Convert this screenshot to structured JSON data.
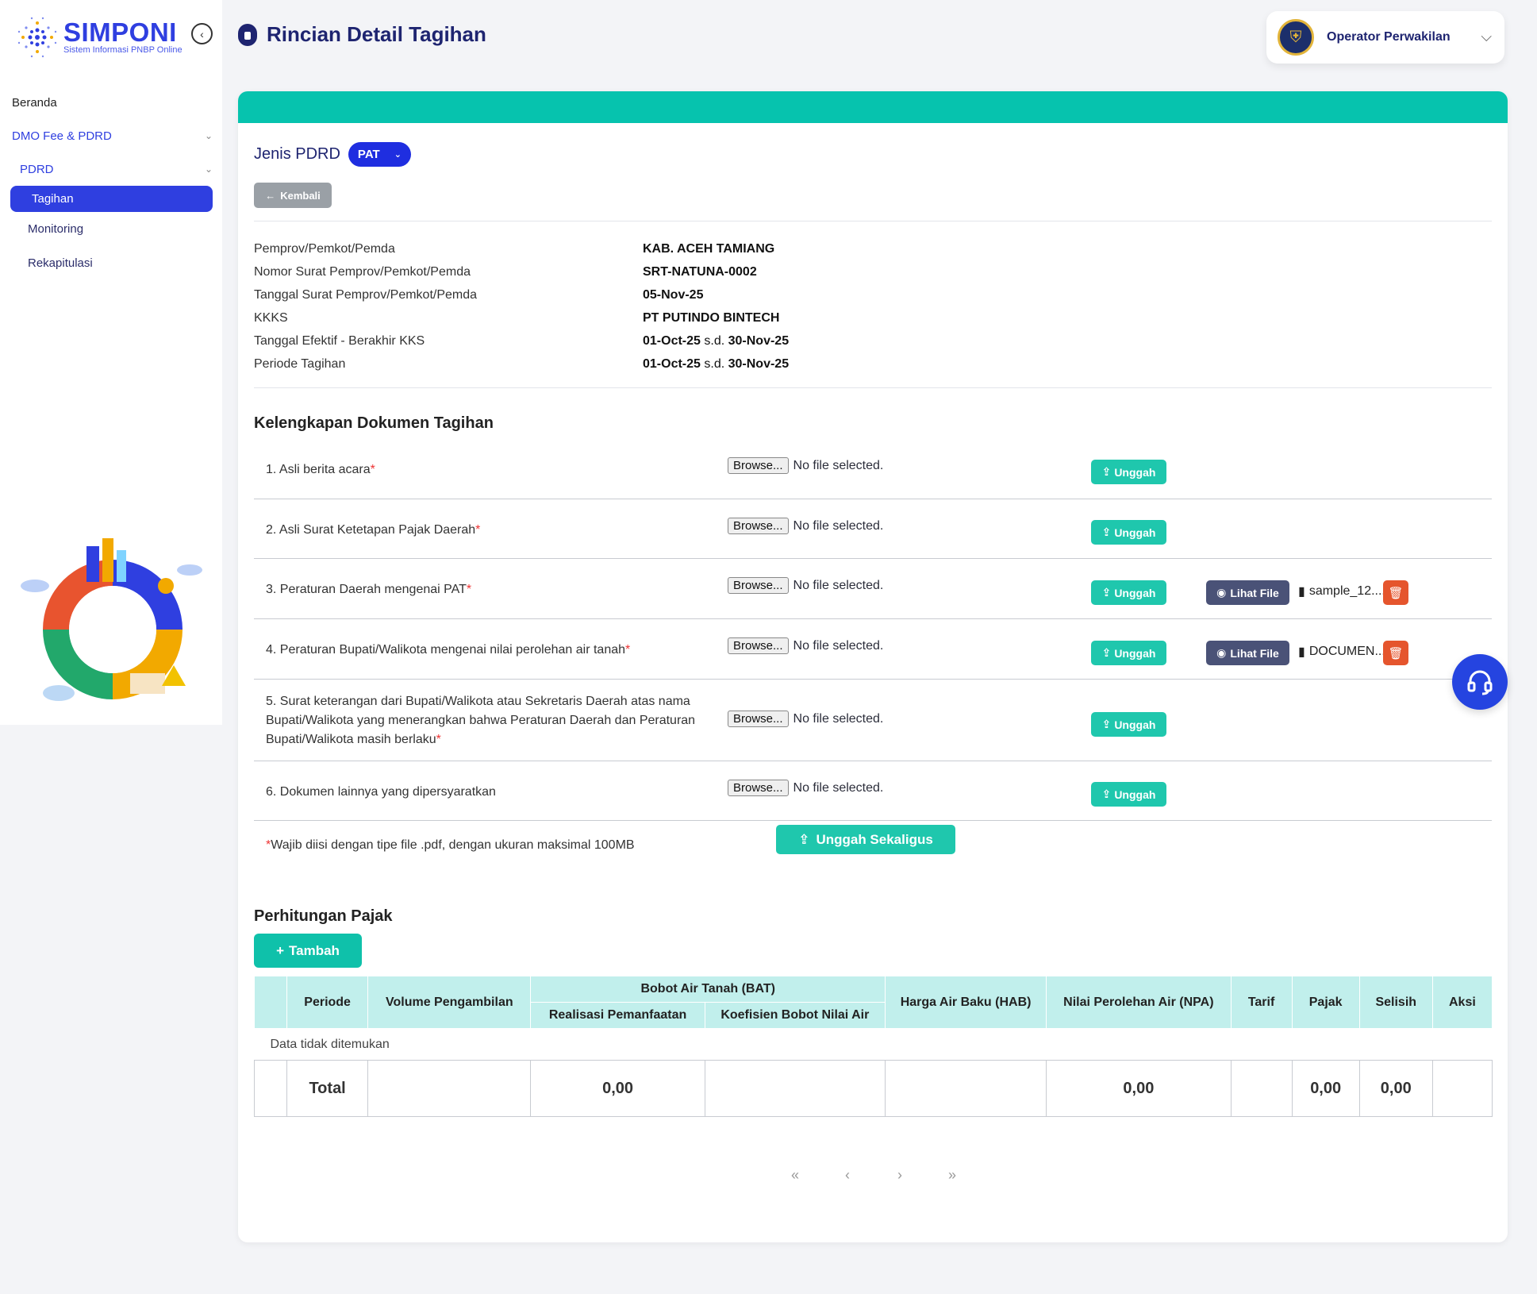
{
  "app": {
    "name": "SIMPONI",
    "subtitle": "Sistem Informasi PNBP Online"
  },
  "sidebar": {
    "items": [
      {
        "label": "Beranda"
      },
      {
        "label": "DMO Fee & PDRD"
      },
      {
        "label": "PDRD"
      },
      {
        "label": "Tagihan"
      },
      {
        "label": "Monitoring"
      },
      {
        "label": "Rekapitulasi"
      }
    ]
  },
  "header": {
    "title": "Rincian Detail Tagihan",
    "user": "Operator Perwakilan"
  },
  "jenis": {
    "label": "Jenis PDRD",
    "value": "PAT"
  },
  "back_label": "Kembali",
  "info": [
    {
      "key": "Pemprov/Pemkot/Pemda",
      "value": "KAB. ACEH TAMIANG"
    },
    {
      "key": "Nomor Surat Pemprov/Pemkot/Pemda",
      "value": "SRT-NATUNA-0002"
    },
    {
      "key": "Tanggal Surat Pemprov/Pemkot/Pemda",
      "value": "05-Nov-25"
    },
    {
      "key": "KKKS",
      "value": "PT PUTINDO BINTECH"
    },
    {
      "key": "Tanggal Efektif - Berakhir KKS",
      "from": "01-Oct-25",
      "sd": "s.d.",
      "to": "30-Nov-25"
    },
    {
      "key": "Periode Tagihan",
      "from": "01-Oct-25",
      "sd": "s.d.",
      "to": "30-Nov-25"
    }
  ],
  "docs": {
    "title": "Kelengkapan Dokumen Tagihan",
    "browse_label": "Browse...",
    "no_file": "No file selected.",
    "upload_label": "Unggah",
    "view_label": "Lihat File",
    "items": [
      {
        "label": "1. Asli berita acara"
      },
      {
        "label": "2. Asli Surat Ketetapan Pajak Daerah"
      },
      {
        "label": "3. Peraturan Daerah mengenai PAT",
        "file": "sample_12...."
      },
      {
        "label": "4. Peraturan Bupati/Walikota mengenai nilai perolehan air tanah",
        "file": "DOCUMEN..."
      },
      {
        "label": "5. Surat keterangan dari Bupati/Walikota atau Sekretaris Daerah atas nama Bupati/Walikota yang menerangkan bahwa Peraturan Daerah dan Peraturan Bupati/Walikota masih berlaku"
      },
      {
        "label": "6. Dokumen lainnya yang dipersyaratkan"
      }
    ],
    "note": "Wajib diisi dengan tipe file .pdf, dengan ukuran maksimal 100MB",
    "upload_all_label": "Unggah Sekaligus"
  },
  "pajak": {
    "title": "Perhitungan Pajak",
    "add_label": "Tambah",
    "headers": {
      "periode": "Periode",
      "volume": "Volume Pengambilan",
      "bat": "Bobot Air Tanah (BAT)",
      "realisasi": "Realisasi Pemanfaatan",
      "koefisien": "Koefisien Bobot Nilai Air",
      "hab": "Harga Air Baku (HAB)",
      "npa": "Nilai Perolehan Air (NPA)",
      "tarif": "Tarif",
      "pajak": "Pajak",
      "selisih": "Selisih",
      "aksi": "Aksi"
    },
    "empty": "Data tidak ditemukan",
    "total": {
      "label": "Total",
      "realisasi": "0,00",
      "npa": "0,00",
      "pajak": "0,00",
      "selisih": "0,00"
    }
  },
  "pager": {
    "first": "«",
    "prev": "‹",
    "next": "›",
    "last": "»"
  },
  "colors": {
    "primary": "#2f3fe0",
    "teal": "#06c3ae",
    "danger": "#e5552d",
    "dark": "#1e2470"
  }
}
